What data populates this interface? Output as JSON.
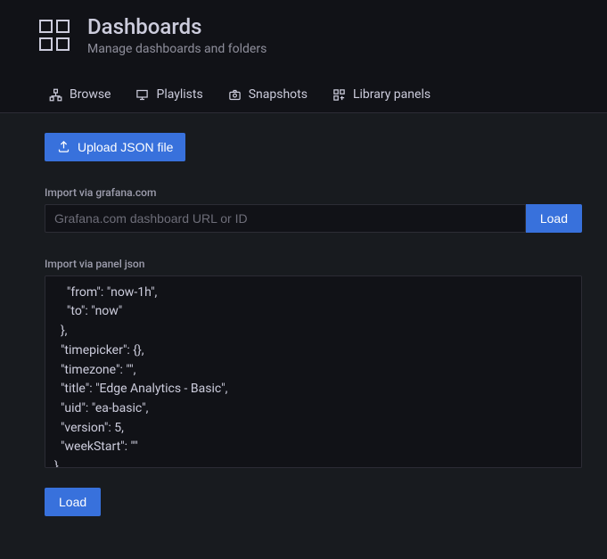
{
  "header": {
    "title": "Dashboards",
    "subtitle": "Manage dashboards and folders"
  },
  "tabs": {
    "browse": "Browse",
    "playlists": "Playlists",
    "snapshots": "Snapshots",
    "library_panels": "Library panels"
  },
  "content": {
    "upload_button": "Upload JSON file",
    "grafana_import_label": "Import via grafana.com",
    "grafana_placeholder": "Grafana.com dashboard URL or ID",
    "grafana_load": "Load",
    "json_import_label": "Import via panel json",
    "json_value": "    \"from\": \"now-1h\",\n    \"to\": \"now\"\n  },\n  \"timepicker\": {},\n  \"timezone\": \"\",\n  \"title\": \"Edge Analytics - Basic\",\n  \"uid\": \"ea-basic\",\n  \"version\": 5,\n  \"weekStart\": \"\"\n}",
    "json_load": "Load"
  }
}
